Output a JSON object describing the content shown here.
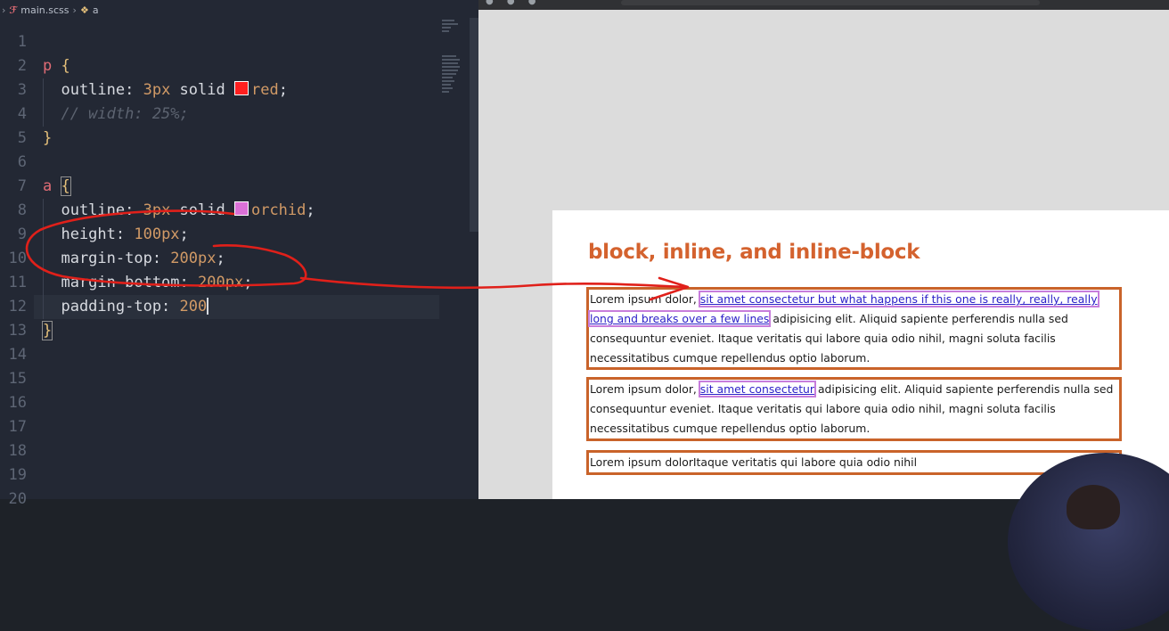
{
  "breadcrumb": {
    "file": "main.scss",
    "symbol": "a"
  },
  "code": [
    {
      "n": "1",
      "parts": []
    },
    {
      "n": "2",
      "parts": [
        {
          "c": "sel",
          "t": "p"
        },
        {
          "c": "plain",
          "t": " "
        },
        {
          "c": "brace",
          "t": "{"
        }
      ]
    },
    {
      "n": "3",
      "parts": [
        {
          "c": "prop",
          "t": "  outline: "
        },
        {
          "c": "num",
          "t": "3px"
        },
        {
          "c": "val",
          "t": " solid "
        },
        {
          "c": "swatch",
          "color": "#ff1f1f"
        },
        {
          "c": "kw",
          "t": "red"
        },
        {
          "c": "val",
          "t": ";"
        }
      ]
    },
    {
      "n": "4",
      "parts": [
        {
          "c": "cmt",
          "t": "  // width: 25%;"
        }
      ]
    },
    {
      "n": "5",
      "parts": [
        {
          "c": "brace",
          "t": "}"
        }
      ]
    },
    {
      "n": "6",
      "parts": []
    },
    {
      "n": "7",
      "parts": [
        {
          "c": "sel",
          "t": "a"
        },
        {
          "c": "plain",
          "t": " "
        },
        {
          "c": "brace-hl",
          "t": "{"
        }
      ]
    },
    {
      "n": "8",
      "parts": [
        {
          "c": "prop",
          "t": "  outline: "
        },
        {
          "c": "num",
          "t": "3px"
        },
        {
          "c": "val",
          "t": " solid "
        },
        {
          "c": "swatch",
          "color": "#da70d6"
        },
        {
          "c": "kw",
          "t": "orchid"
        },
        {
          "c": "val",
          "t": ";"
        }
      ]
    },
    {
      "n": "9",
      "parts": [
        {
          "c": "prop",
          "t": "  height: "
        },
        {
          "c": "num",
          "t": "100px"
        },
        {
          "c": "val",
          "t": ";"
        }
      ]
    },
    {
      "n": "10",
      "parts": [
        {
          "c": "prop",
          "t": "  margin-top: "
        },
        {
          "c": "num",
          "t": "200px"
        },
        {
          "c": "val",
          "t": ";"
        }
      ]
    },
    {
      "n": "11",
      "parts": [
        {
          "c": "prop",
          "t": "  margin-bottom: "
        },
        {
          "c": "num",
          "t": "200px"
        },
        {
          "c": "val",
          "t": ";"
        }
      ]
    },
    {
      "n": "12",
      "parts": [
        {
          "c": "prop",
          "t": "  padding-top: "
        },
        {
          "c": "num",
          "t": "200"
        },
        {
          "c": "caret"
        }
      ]
    },
    {
      "n": "13",
      "parts": [
        {
          "c": "brace-hl",
          "t": "}"
        }
      ]
    },
    {
      "n": "14",
      "parts": []
    },
    {
      "n": "15",
      "parts": []
    },
    {
      "n": "16",
      "parts": []
    },
    {
      "n": "17",
      "parts": []
    },
    {
      "n": "18",
      "parts": []
    },
    {
      "n": "19",
      "parts": []
    },
    {
      "n": "20",
      "parts": []
    }
  ],
  "preview": {
    "heading": "block, inline, and inline-block",
    "paragraphs": [
      {
        "before": "Lorem ipsum dolor, ",
        "link": "sit amet consectetur but what happens if this one is really, really, really long and breaks over a few lines",
        "after": " adipisicing elit. Aliquid sapiente perferendis nulla sed consequuntur eveniet. Itaque veritatis qui labore quia odio nihil, magni soluta facilis necessitatibus cumque repellendus optio laborum."
      },
      {
        "before": "Lorem ipsum dolor, ",
        "link": "sit amet consectetur",
        "after": " adipisicing elit. Aliquid sapiente perferendis nulla sed consequuntur eveniet. Itaque veritatis qui labore quia odio nihil, magni soluta facilis necessitatibus cumque repellendus optio laborum."
      },
      {
        "before": "Lorem ipsum dolorItaque veritatis qui labore quia odio nihil",
        "link": "",
        "after": ""
      }
    ]
  },
  "colors": {
    "annotation": "#e0201a",
    "outline_p": "#c9632a",
    "outline_a": "#c77ddb",
    "heading": "#d4622e"
  }
}
